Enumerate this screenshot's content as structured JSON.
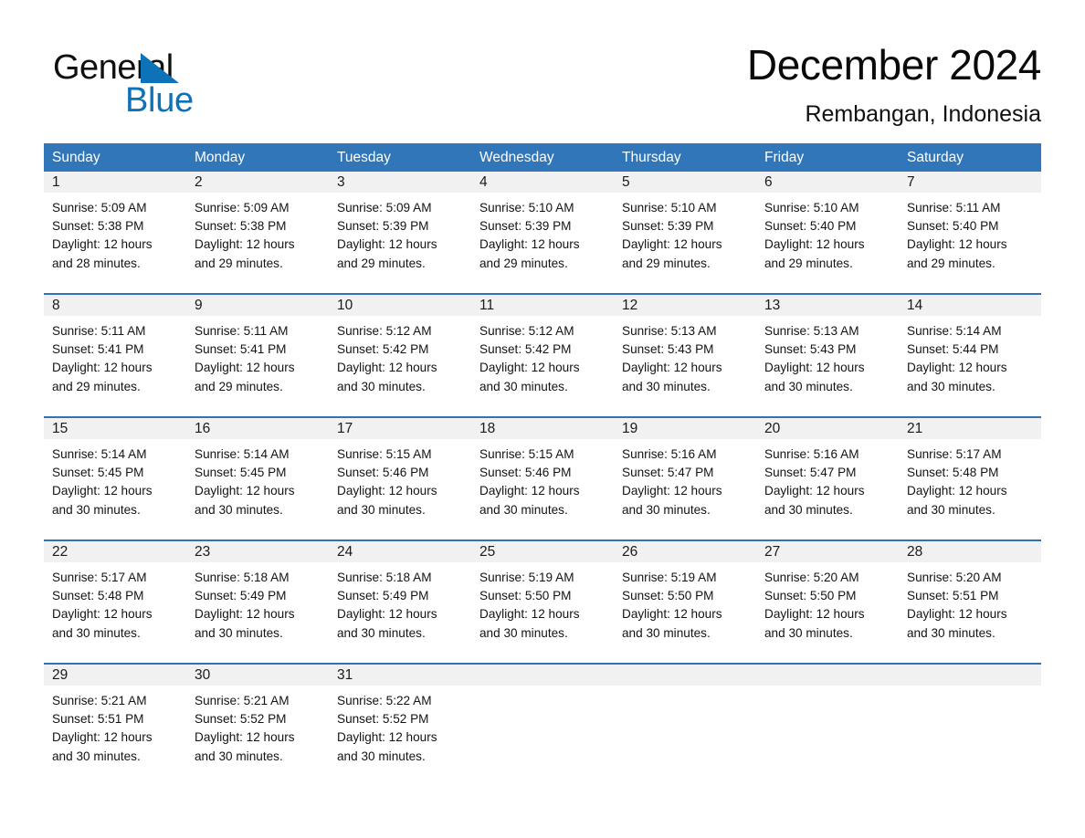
{
  "brand": {
    "name_part1": "General",
    "name_part2": "Blue",
    "accent_color": "#0E72B8"
  },
  "header": {
    "title": "December 2024",
    "subtitle": "Rembangan, Indonesia"
  },
  "calendar": {
    "header_bg": "#3076B8",
    "week_divider_color": "#2E74B5",
    "daynum_band_bg": "#F1F1F1",
    "weekdays": [
      "Sunday",
      "Monday",
      "Tuesday",
      "Wednesday",
      "Thursday",
      "Friday",
      "Saturday"
    ],
    "weeks": [
      [
        {
          "day": "1",
          "sunrise": "Sunrise: 5:09 AM",
          "sunset": "Sunset: 5:38 PM",
          "daylight_line1": "Daylight: 12 hours",
          "daylight_line2": "and 28 minutes."
        },
        {
          "day": "2",
          "sunrise": "Sunrise: 5:09 AM",
          "sunset": "Sunset: 5:38 PM",
          "daylight_line1": "Daylight: 12 hours",
          "daylight_line2": "and 29 minutes."
        },
        {
          "day": "3",
          "sunrise": "Sunrise: 5:09 AM",
          "sunset": "Sunset: 5:39 PM",
          "daylight_line1": "Daylight: 12 hours",
          "daylight_line2": "and 29 minutes."
        },
        {
          "day": "4",
          "sunrise": "Sunrise: 5:10 AM",
          "sunset": "Sunset: 5:39 PM",
          "daylight_line1": "Daylight: 12 hours",
          "daylight_line2": "and 29 minutes."
        },
        {
          "day": "5",
          "sunrise": "Sunrise: 5:10 AM",
          "sunset": "Sunset: 5:39 PM",
          "daylight_line1": "Daylight: 12 hours",
          "daylight_line2": "and 29 minutes."
        },
        {
          "day": "6",
          "sunrise": "Sunrise: 5:10 AM",
          "sunset": "Sunset: 5:40 PM",
          "daylight_line1": "Daylight: 12 hours",
          "daylight_line2": "and 29 minutes."
        },
        {
          "day": "7",
          "sunrise": "Sunrise: 5:11 AM",
          "sunset": "Sunset: 5:40 PM",
          "daylight_line1": "Daylight: 12 hours",
          "daylight_line2": "and 29 minutes."
        }
      ],
      [
        {
          "day": "8",
          "sunrise": "Sunrise: 5:11 AM",
          "sunset": "Sunset: 5:41 PM",
          "daylight_line1": "Daylight: 12 hours",
          "daylight_line2": "and 29 minutes."
        },
        {
          "day": "9",
          "sunrise": "Sunrise: 5:11 AM",
          "sunset": "Sunset: 5:41 PM",
          "daylight_line1": "Daylight: 12 hours",
          "daylight_line2": "and 29 minutes."
        },
        {
          "day": "10",
          "sunrise": "Sunrise: 5:12 AM",
          "sunset": "Sunset: 5:42 PM",
          "daylight_line1": "Daylight: 12 hours",
          "daylight_line2": "and 30 minutes."
        },
        {
          "day": "11",
          "sunrise": "Sunrise: 5:12 AM",
          "sunset": "Sunset: 5:42 PM",
          "daylight_line1": "Daylight: 12 hours",
          "daylight_line2": "and 30 minutes."
        },
        {
          "day": "12",
          "sunrise": "Sunrise: 5:13 AM",
          "sunset": "Sunset: 5:43 PM",
          "daylight_line1": "Daylight: 12 hours",
          "daylight_line2": "and 30 minutes."
        },
        {
          "day": "13",
          "sunrise": "Sunrise: 5:13 AM",
          "sunset": "Sunset: 5:43 PM",
          "daylight_line1": "Daylight: 12 hours",
          "daylight_line2": "and 30 minutes."
        },
        {
          "day": "14",
          "sunrise": "Sunrise: 5:14 AM",
          "sunset": "Sunset: 5:44 PM",
          "daylight_line1": "Daylight: 12 hours",
          "daylight_line2": "and 30 minutes."
        }
      ],
      [
        {
          "day": "15",
          "sunrise": "Sunrise: 5:14 AM",
          "sunset": "Sunset: 5:45 PM",
          "daylight_line1": "Daylight: 12 hours",
          "daylight_line2": "and 30 minutes."
        },
        {
          "day": "16",
          "sunrise": "Sunrise: 5:14 AM",
          "sunset": "Sunset: 5:45 PM",
          "daylight_line1": "Daylight: 12 hours",
          "daylight_line2": "and 30 minutes."
        },
        {
          "day": "17",
          "sunrise": "Sunrise: 5:15 AM",
          "sunset": "Sunset: 5:46 PM",
          "daylight_line1": "Daylight: 12 hours",
          "daylight_line2": "and 30 minutes."
        },
        {
          "day": "18",
          "sunrise": "Sunrise: 5:15 AM",
          "sunset": "Sunset: 5:46 PM",
          "daylight_line1": "Daylight: 12 hours",
          "daylight_line2": "and 30 minutes."
        },
        {
          "day": "19",
          "sunrise": "Sunrise: 5:16 AM",
          "sunset": "Sunset: 5:47 PM",
          "daylight_line1": "Daylight: 12 hours",
          "daylight_line2": "and 30 minutes."
        },
        {
          "day": "20",
          "sunrise": "Sunrise: 5:16 AM",
          "sunset": "Sunset: 5:47 PM",
          "daylight_line1": "Daylight: 12 hours",
          "daylight_line2": "and 30 minutes."
        },
        {
          "day": "21",
          "sunrise": "Sunrise: 5:17 AM",
          "sunset": "Sunset: 5:48 PM",
          "daylight_line1": "Daylight: 12 hours",
          "daylight_line2": "and 30 minutes."
        }
      ],
      [
        {
          "day": "22",
          "sunrise": "Sunrise: 5:17 AM",
          "sunset": "Sunset: 5:48 PM",
          "daylight_line1": "Daylight: 12 hours",
          "daylight_line2": "and 30 minutes."
        },
        {
          "day": "23",
          "sunrise": "Sunrise: 5:18 AM",
          "sunset": "Sunset: 5:49 PM",
          "daylight_line1": "Daylight: 12 hours",
          "daylight_line2": "and 30 minutes."
        },
        {
          "day": "24",
          "sunrise": "Sunrise: 5:18 AM",
          "sunset": "Sunset: 5:49 PM",
          "daylight_line1": "Daylight: 12 hours",
          "daylight_line2": "and 30 minutes."
        },
        {
          "day": "25",
          "sunrise": "Sunrise: 5:19 AM",
          "sunset": "Sunset: 5:50 PM",
          "daylight_line1": "Daylight: 12 hours",
          "daylight_line2": "and 30 minutes."
        },
        {
          "day": "26",
          "sunrise": "Sunrise: 5:19 AM",
          "sunset": "Sunset: 5:50 PM",
          "daylight_line1": "Daylight: 12 hours",
          "daylight_line2": "and 30 minutes."
        },
        {
          "day": "27",
          "sunrise": "Sunrise: 5:20 AM",
          "sunset": "Sunset: 5:50 PM",
          "daylight_line1": "Daylight: 12 hours",
          "daylight_line2": "and 30 minutes."
        },
        {
          "day": "28",
          "sunrise": "Sunrise: 5:20 AM",
          "sunset": "Sunset: 5:51 PM",
          "daylight_line1": "Daylight: 12 hours",
          "daylight_line2": "and 30 minutes."
        }
      ],
      [
        {
          "day": "29",
          "sunrise": "Sunrise: 5:21 AM",
          "sunset": "Sunset: 5:51 PM",
          "daylight_line1": "Daylight: 12 hours",
          "daylight_line2": "and 30 minutes."
        },
        {
          "day": "30",
          "sunrise": "Sunrise: 5:21 AM",
          "sunset": "Sunset: 5:52 PM",
          "daylight_line1": "Daylight: 12 hours",
          "daylight_line2": "and 30 minutes."
        },
        {
          "day": "31",
          "sunrise": "Sunrise: 5:22 AM",
          "sunset": "Sunset: 5:52 PM",
          "daylight_line1": "Daylight: 12 hours",
          "daylight_line2": "and 30 minutes."
        },
        {
          "day": "",
          "sunrise": "",
          "sunset": "",
          "daylight_line1": "",
          "daylight_line2": ""
        },
        {
          "day": "",
          "sunrise": "",
          "sunset": "",
          "daylight_line1": "",
          "daylight_line2": ""
        },
        {
          "day": "",
          "sunrise": "",
          "sunset": "",
          "daylight_line1": "",
          "daylight_line2": ""
        },
        {
          "day": "",
          "sunrise": "",
          "sunset": "",
          "daylight_line1": "",
          "daylight_line2": ""
        }
      ]
    ]
  }
}
